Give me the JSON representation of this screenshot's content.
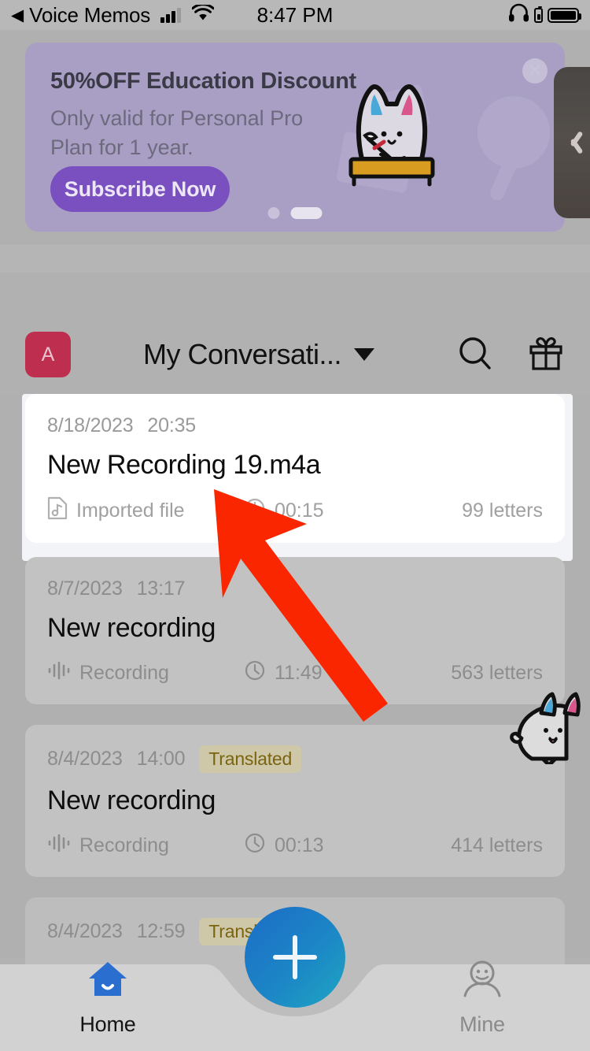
{
  "status_bar": {
    "back_label": "Voice Memos",
    "back_chevron": "◀",
    "time": "8:47 PM",
    "signal_icon": "cellular-signal-icon",
    "wifi_icon": "wifi-icon",
    "headphones_icon": "headphones-icon",
    "battery_icon": "battery-icon"
  },
  "banner": {
    "title": "50%OFF Education Discount",
    "subtitle": "Only valid for Personal Pro Plan for 1 year.",
    "cta_label": "Subscribe Now",
    "close_icon": "close-icon",
    "mascot_icon": "cat-graduate-icon",
    "page_count": 2,
    "active_page": 2,
    "bg_color": "#a99fc4",
    "cta_color": "#7a4fbf"
  },
  "side_tab": {
    "icon": "chevron-left-icon",
    "color": "#4d4845"
  },
  "header": {
    "avatar_letter": "A",
    "avatar_color": "#bd2e4f",
    "title": "My Conversati...",
    "dropdown_icon": "chevron-down-icon",
    "search_icon": "search-icon",
    "gift_icon": "gift-icon"
  },
  "list": {
    "items": [
      {
        "date": "8/18/2023",
        "time": "20:35",
        "badge": "",
        "title": "New Recording 19.m4a",
        "type_icon": "music-file-icon",
        "type_label": "Imported file",
        "duration_icon": "clock-icon",
        "duration": "00:15",
        "letters": "99 letters",
        "selected": true
      },
      {
        "date": "8/7/2023",
        "time": "13:17",
        "badge": "",
        "title": "New recording",
        "type_icon": "waveform-icon",
        "type_label": "Recording",
        "duration_icon": "clock-icon",
        "duration": "11:49",
        "letters": "563 letters",
        "selected": false
      },
      {
        "date": "8/4/2023",
        "time": "14:00",
        "badge": "Translated",
        "title": "New recording",
        "type_icon": "waveform-icon",
        "type_label": "Recording",
        "duration_icon": "clock-icon",
        "duration": "00:13",
        "letters": "414 letters",
        "selected": false
      },
      {
        "date": "8/4/2023",
        "time": "12:59",
        "badge": "Translated",
        "title": "",
        "type_icon": "waveform-icon",
        "type_label": "",
        "duration_icon": "clock-icon",
        "duration": "",
        "letters": "",
        "selected": false
      }
    ]
  },
  "mascot": {
    "icon": "cat-peek-icon"
  },
  "fab": {
    "icon": "plus-icon",
    "gradient_from": "#1c6cc6",
    "gradient_to": "#1ea6c2"
  },
  "tabbar": {
    "home_label": "Home",
    "home_icon": "home-icon",
    "home_active_color": "#2a6fd0",
    "mine_label": "Mine",
    "mine_icon": "person-icon",
    "mine_color": "#8a8a8a"
  },
  "annotation": {
    "arrow_color": "#fa2600",
    "arrow_icon": "pointer-arrow-icon"
  }
}
